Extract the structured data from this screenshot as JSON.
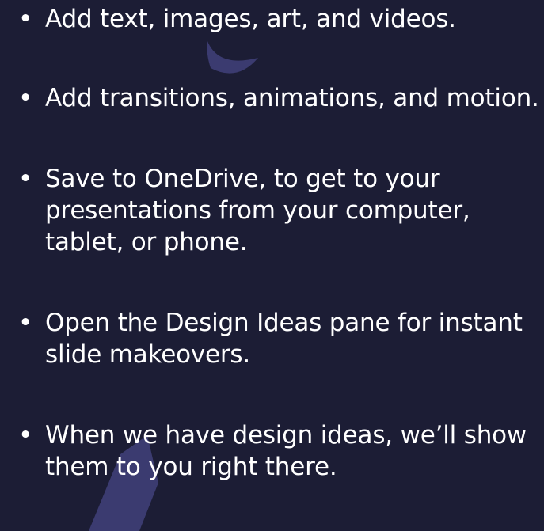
{
  "slide": {
    "bullet_glyph": "•",
    "bullets": [
      "Add text, images, art, and videos.",
      "Add transitions, animations, and motion.",
      "Save to OneDrive, to get to your presentations from your computer, tablet, or phone.",
      "Open the Design Ideas pane for instant slide makeovers.",
      "When we have design ideas, we’ll show them to you right there."
    ]
  },
  "colors": {
    "background": "#1c1d35",
    "text": "#ffffff",
    "accent_shape": "#3b3b70"
  }
}
